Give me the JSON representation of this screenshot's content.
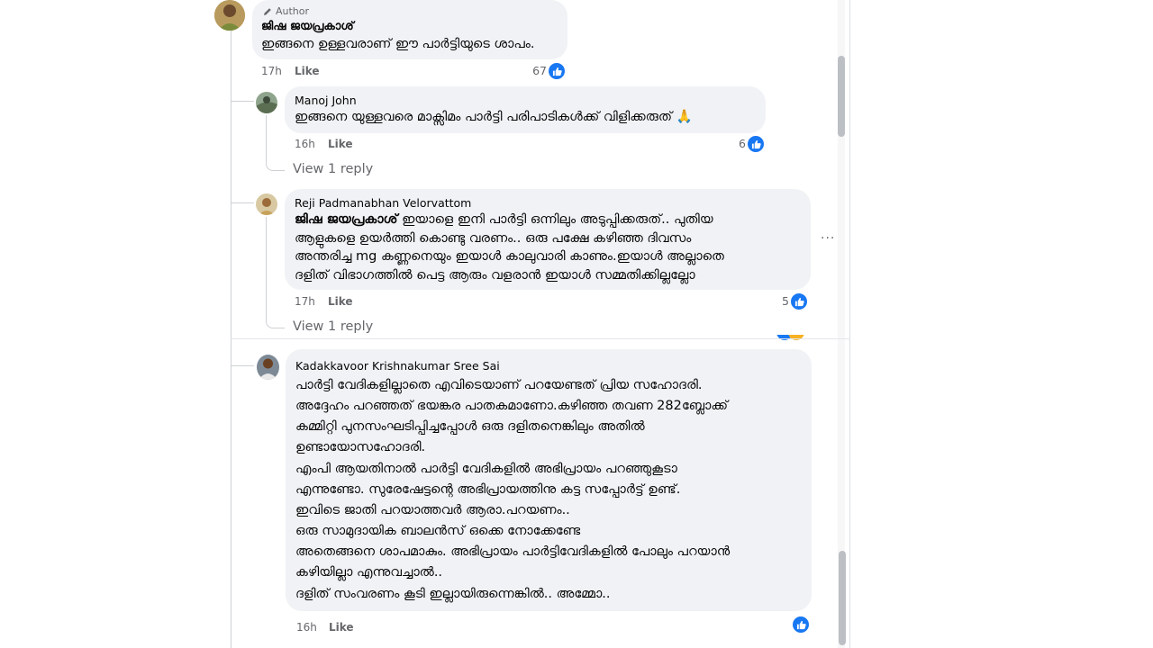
{
  "comments": [
    {
      "author": "ജിഷ ജയപ്രകാശ്",
      "author_tag": "Author",
      "text": "ഇങ്ങനെ ഉള്ളവരാണ് ഈ പാർട്ടിയുടെ ശാപം.",
      "time": "17h",
      "like_label": "Like",
      "reactions": "67"
    },
    {
      "author": "Manoj John",
      "text": "ഇങ്ങനെ യുള്ളവരെ മാക്സിമം പാർട്ടി പരിപാടികൾക്ക് വിളിക്കരുത് 🙏",
      "time": "16h",
      "like_label": "Like",
      "reactions": "6",
      "view_replies": "View 1 reply"
    },
    {
      "author": "Reji Padmanabhan Velorvattom",
      "mention": "ജിഷ ജയപ്രകാശ്",
      "lines": [
        " ഇയാളെ ഇനി പാർട്ടി ഒന്നിലും അടുപ്പിക്കരുത്.. പുതിയ",
        "ആളുകളെ ഉയർത്തി കൊണ്ടു വരണം.. ഒരു പക്ഷേ കഴിഞ്ഞ ദിവസം",
        "അന്തരിച്ച mg കണ്ണനെയും ഇയാൾ കാലുവാരി കാണും.ഇയാൾ അല്ലാതെ",
        "ദളിത് വിഭാഗത്തിൽ പെട്ട ആരും വളരാൻ ഇയാൾ സമ്മതിക്കില്ലല്ലോ"
      ],
      "time": "17h",
      "like_label": "Like",
      "reactions": "5",
      "view_replies": "View 1 reply",
      "more": "···"
    },
    {
      "author": "Kadakkavoor Krishnakumar Sree Sai",
      "lines": [
        "പാർട്ടി വേദികളില്ലാതെ എവിടെയാണ് പറയേണ്ടത് പ്രിയ സഹോദരി.",
        "അദ്ദേഹം പറഞ്ഞത് ഭയങ്കര പാതകമാണോ.കഴിഞ്ഞ തവണ 282ബ്ലോക്ക്",
        "കമ്മിറ്റി പുനസംഘടിപ്പിച്ചപ്പോൾ ഒരു ദളിതനെങ്കിലും അതിൽ",
        "ഉണ്ടായോസഹോദരി.",
        "എംപി ആയതിനാൽ പാർട്ടി വേദികളിൽ അഭിപ്രായം പറഞ്ഞുകൂടാ",
        "എന്നുണ്ടോ. സുരേഷേട്ടന്റെ അഭിപ്രായത്തിനു കട്ട സപ്പോർട്ട് ഉണ്ട്.",
        "ഇവിടെ ജാതി പറയാത്തവർ ആരാ.പറയണം..",
        "ഒരു സാമുദായിക ബാലൻസ് ഒക്കെ നോക്കേണ്ടേ",
        "അതെങ്ങനെ ശാപമാകും. അഭിപ്രായം പാർട്ടിവേദികളിൽ പോലും പറയാൻ",
        "കഴിയില്ലാ എന്നുവച്ചാൽ..",
        "ദളിത് സംവരണം കൂടി ഇല്ലായിരുന്നെങ്കിൽ.. അമ്മോ.."
      ],
      "time": "16h",
      "like_label": "Like"
    }
  ],
  "colors": {
    "bubble": "#f0f2f5",
    "like_blue": "#1877f2",
    "meta_grey": "#65676b",
    "thread_line": "#ced0d4"
  }
}
